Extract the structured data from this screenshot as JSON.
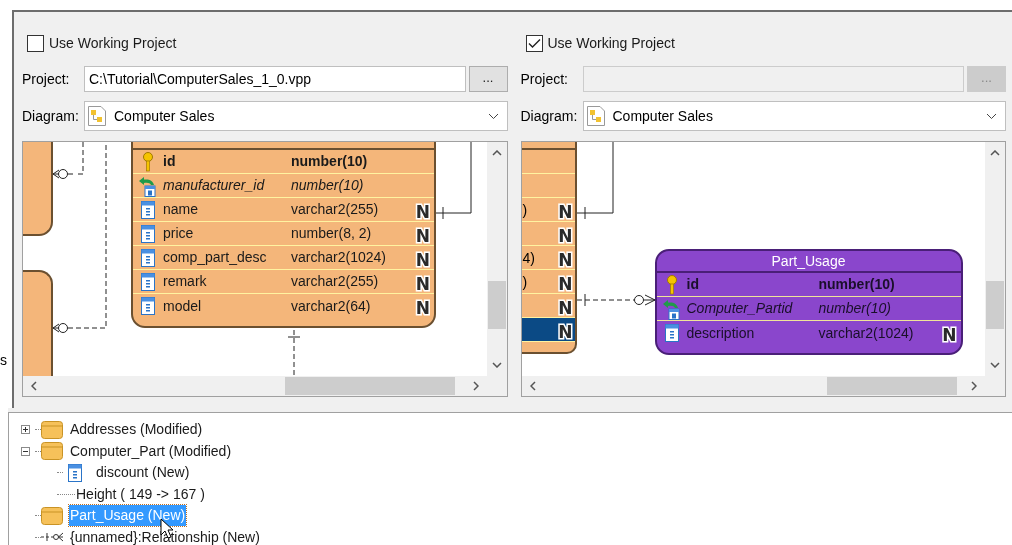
{
  "panels": [
    {
      "use_working_project": {
        "label": "Use Working Project",
        "checked": false
      },
      "project": {
        "label": "Project:",
        "value": "C:\\Tutorial\\ComputerSales_1_0.vpp",
        "disabled": false,
        "browse": "..."
      },
      "diagram": {
        "label": "Diagram:",
        "value": "Computer Sales"
      },
      "entity": {
        "columns": [
          {
            "kind": "pk",
            "name": "id",
            "type": "number(10)"
          },
          {
            "kind": "fk",
            "name": "manufacturer_id",
            "type": "number(10)"
          },
          {
            "kind": "column",
            "name": "name",
            "type": "varchar2(255)",
            "badge": "N"
          },
          {
            "kind": "column",
            "name": "price",
            "type": "number(8, 2)",
            "badge": "N"
          },
          {
            "kind": "column",
            "name": "comp_part_desc",
            "type": "varchar2(1024)",
            "badge": "N"
          },
          {
            "kind": "column",
            "name": "remark",
            "type": "varchar2(255)",
            "badge": "N"
          },
          {
            "kind": "column",
            "name": "model",
            "type": "varchar2(64)",
            "badge": "N"
          }
        ]
      }
    },
    {
      "use_working_project": {
        "label": "Use Working Project",
        "checked": true
      },
      "project": {
        "label": "Project:",
        "disabled": true,
        "browse": "..."
      },
      "diagram": {
        "label": "Diagram:",
        "value": "Computer Sales"
      },
      "side_rows": [
        {
          "selected": false
        },
        {
          "selected": false
        },
        {
          "fragment": ")",
          "badge": "N",
          "selected": false
        },
        {
          "badge": "N",
          "selected": false
        },
        {
          "fragment": "4)",
          "badge": "N",
          "selected": false
        },
        {
          "fragment": ")",
          "badge": "N",
          "selected": false
        },
        {
          "badge": "N",
          "selected": false
        },
        {
          "badge": "N",
          "selected": true
        }
      ],
      "entity": {
        "title": "Part_Usage",
        "columns": [
          {
            "kind": "pk",
            "name": "id",
            "type": "number(10)"
          },
          {
            "kind": "fk",
            "name": "Computer_Partid",
            "type": "number(10)"
          },
          {
            "kind": "column",
            "name": "description",
            "type": "varchar2(1024)",
            "badge": "N"
          }
        ]
      }
    }
  ],
  "edge_text": "s",
  "tree": [
    {
      "kind": "table",
      "label": "Addresses (Modified)",
      "expanded": false,
      "selected": false
    },
    {
      "kind": "table",
      "label": "Computer_Part (Modified)",
      "expanded": true,
      "selected": false,
      "children": [
        {
          "kind": "column",
          "label": "discount (New)",
          "selected": false
        },
        {
          "kind": "property",
          "label": "Height ( 149 -> 167 )",
          "selected": false
        }
      ]
    },
    {
      "kind": "table",
      "label": "Part_Usage (New)",
      "selected": true
    },
    {
      "kind": "relationship",
      "label": "{unnamed}:Relationship (New)",
      "selected": false
    }
  ]
}
